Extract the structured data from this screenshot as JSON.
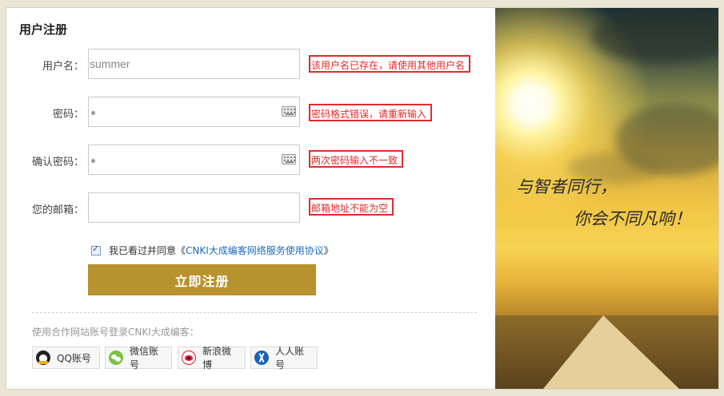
{
  "form": {
    "title": "用户注册",
    "username": {
      "label": "用户名：",
      "value": "summer",
      "error": "该用户名已存在，请使用其他用户名"
    },
    "password": {
      "label": "密码：",
      "error": "密码格式错误，请重新输入"
    },
    "confirm_password": {
      "label": "确认密码：",
      "error": "两次密码输入不一致"
    },
    "email": {
      "label": "您的邮箱：",
      "error": "邮箱地址不能为空"
    },
    "agreement": {
      "prefix": "我已看过并同意《",
      "link": "CNKI大成编客网络服务使用协议",
      "suffix": "》",
      "checked": true
    },
    "submit_label": "立即注册"
  },
  "partners": {
    "intro": "使用合作网站账号登录CNKI大成编客：",
    "items": [
      {
        "label": "QQ账号",
        "icon": "qq-icon"
      },
      {
        "label": "微信账号",
        "icon": "wechat-icon"
      },
      {
        "label": "新浪微博",
        "icon": "weibo-icon"
      },
      {
        "label": "人人账号",
        "icon": "renren-icon"
      }
    ]
  },
  "banner": {
    "line1": "与智者同行，",
    "line2": "你会不同凡响！"
  },
  "colors": {
    "submit": "#b8922e",
    "error": "#e22b2b",
    "link": "#1c69b7"
  }
}
